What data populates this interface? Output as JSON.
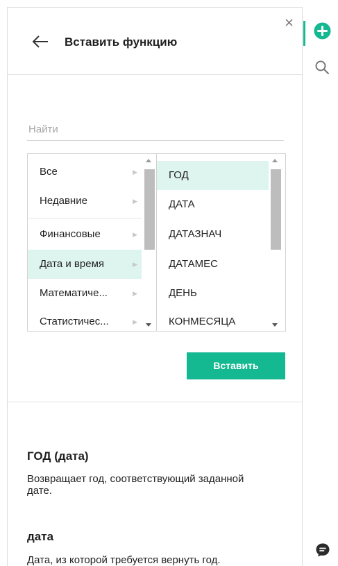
{
  "header": {
    "title": "Вставить функцию",
    "close_glyph": "×"
  },
  "search": {
    "placeholder": "Найти",
    "value": ""
  },
  "categories": [
    {
      "label": "Все",
      "selected": false
    },
    {
      "label": "Недавние",
      "selected": false
    },
    {
      "label": "Финансовые",
      "selected": false
    },
    {
      "label": "Дата и время",
      "selected": true
    },
    {
      "label": "Математиче...",
      "selected": false
    },
    {
      "label": "Статистичес...",
      "selected": false
    }
  ],
  "functions": [
    {
      "label": "ГОД",
      "selected": true
    },
    {
      "label": "ДАТА",
      "selected": false
    },
    {
      "label": "ДАТАЗНАЧ",
      "selected": false
    },
    {
      "label": "ДАТАМЕС",
      "selected": false
    },
    {
      "label": "ДЕНЬ",
      "selected": false
    },
    {
      "label": "КОНМЕСЯЦА",
      "selected": false
    }
  ],
  "insert_button": {
    "label": "Вставить"
  },
  "details": {
    "signature": "ГОД (дата)",
    "description": "Возвращает год, соответствующий заданной дате.",
    "argument_name": "дата",
    "argument_description": "Дата, из которой требуется вернуть год."
  },
  "rail": {
    "icons": [
      "plus-circle-icon",
      "search-icon",
      "chat-icon"
    ]
  },
  "colors": {
    "accent": "#14b891",
    "selection": "#def4ef"
  }
}
